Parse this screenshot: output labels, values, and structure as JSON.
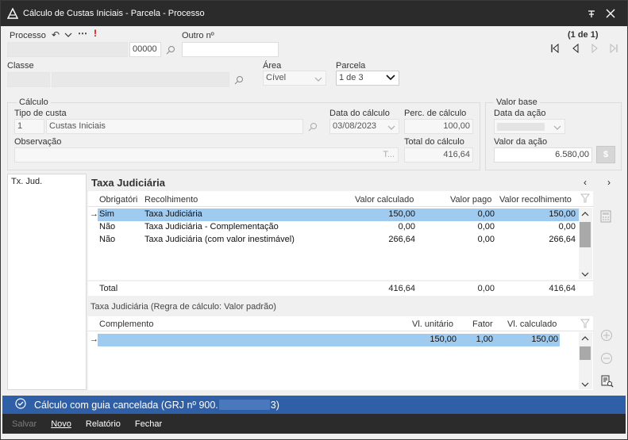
{
  "window": {
    "title": "Cálculo de Custas Iniciais - Parcela - Processo"
  },
  "header": {
    "processo_label": "Processo",
    "processo_suffix": "00000",
    "outro_label": "Outro nº",
    "pager": "(1 de 1)",
    "classe_label": "Classe",
    "area_label": "Área",
    "area_value": "Cível",
    "parcela_label": "Parcela",
    "parcela_value": "1 de 3"
  },
  "calculo": {
    "group_label": "Cálculo",
    "tipo_label": "Tipo de custa",
    "tipo_code": "1",
    "tipo_value": "Custas Iniciais",
    "data_label": "Data do cálculo",
    "data_value": "03/08/2023",
    "perc_label": "Perc. de cálculo",
    "perc_value": "100,00",
    "obs_label": "Observação",
    "obs_placeholder": "T...",
    "total_label": "Total do cálculo",
    "total_value": "416,64"
  },
  "valor_base": {
    "group_label": "Valor base",
    "data_acao_label": "Data da ação",
    "valor_acao_label": "Valor da ação",
    "valor_acao_value": "6.580,00"
  },
  "left_list": {
    "item": "Tx. Jud."
  },
  "taxa": {
    "title": "Taxa Judiciária",
    "columns": [
      "Obrigatóri",
      "Recolhimento",
      "Valor calculado",
      "Valor pago",
      "Valor recolhimento"
    ],
    "rows": [
      {
        "obrig": "Sim",
        "recolhimento": "Taxa Judiciária",
        "calc": "150,00",
        "pago": "0,00",
        "recol": "150,00"
      },
      {
        "obrig": "Não",
        "recolhimento": "Taxa Judiciária - Complementação",
        "calc": "0,00",
        "pago": "0,00",
        "recol": "0,00"
      },
      {
        "obrig": "Não",
        "recolhimento": "Taxa Judiciária (com valor inestimável)",
        "calc": "266,64",
        "pago": "0,00",
        "recol": "266,64"
      }
    ],
    "total_label": "Total",
    "total_calc": "416,64",
    "total_pago": "0,00",
    "total_recol": "416,64"
  },
  "regra": {
    "title": "Taxa Judiciária (Regra de cálculo: Valor padrão)",
    "columns": [
      "Complemento",
      "Vl. unitário",
      "Fator",
      "Vl. calculado"
    ],
    "rows": [
      {
        "complemento": "",
        "unit": "150,00",
        "fator": "1,00",
        "calc": "150,00"
      }
    ]
  },
  "status": {
    "text": "Cálculo com guia cancelada (GRJ nº 900.",
    "text_end": "3)"
  },
  "footer": {
    "salvar": "Salvar",
    "novo": "Novo",
    "relatorio": "Relatório",
    "fechar": "Fechar"
  },
  "colors": {
    "titlebar": "#2b2b2b",
    "status_bar": "#2f5fa6",
    "selection": "#9fcbf0"
  }
}
